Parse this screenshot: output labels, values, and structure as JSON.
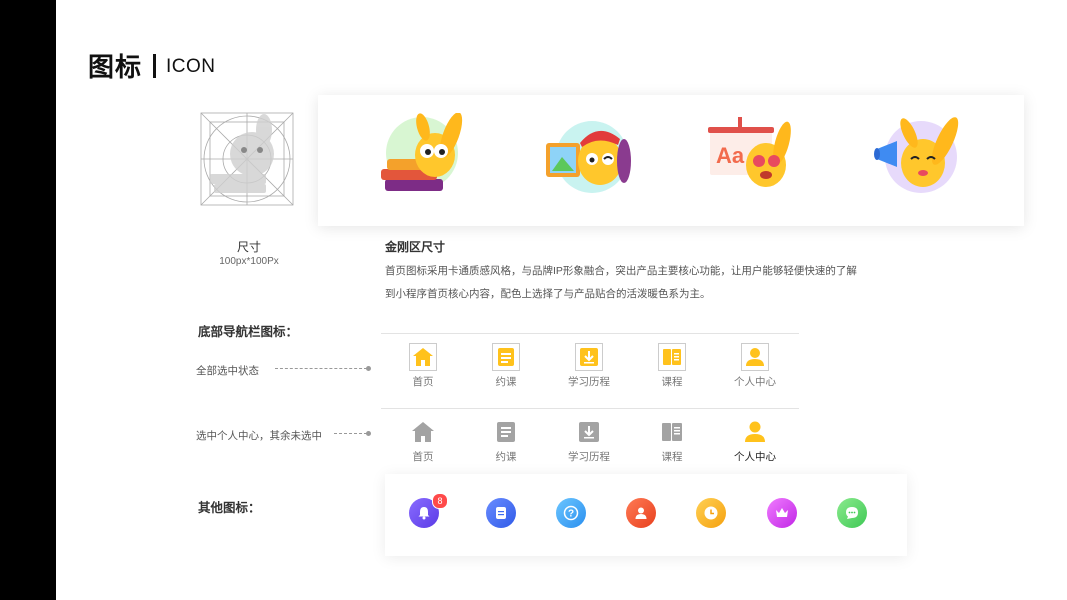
{
  "header": {
    "title_zh": "图标",
    "title_en": "ICON"
  },
  "size_spec": {
    "label": "尺寸",
    "value": "100px*100Px"
  },
  "jingang": {
    "title": "金刚区尺寸",
    "line1": "首页图标采用卡通质感风格，与品牌IP形象融合，突出产品主要核心功能，让用户能够轻便快速的了解",
    "line2": "到小程序首页核心内容，配色上选择了与产品贴合的活泼暖色系为主。",
    "mascots": [
      "books-mascot-icon",
      "painting-mascot-icon",
      "language-mascot-icon",
      "megaphone-mascot-icon"
    ]
  },
  "bottom_nav": {
    "section_title": "底部导航栏图标：",
    "row1_label": "全部选中状态",
    "row2_label": "选中个人中心，其余未选中",
    "items": [
      {
        "label": "首页",
        "icon": "home-icon"
      },
      {
        "label": "约课",
        "icon": "booking-icon"
      },
      {
        "label": "学习历程",
        "icon": "download-icon"
      },
      {
        "label": "课程",
        "icon": "book-icon"
      },
      {
        "label": "个人中心",
        "icon": "user-icon"
      }
    ],
    "colors": {
      "active": "#FFC21C",
      "inactive": "#A3A3A3"
    }
  },
  "other_icons": {
    "section_title": "其他图标：",
    "notification_count": "8",
    "icons": [
      {
        "name": "bell-icon",
        "color": "#6A4BF2"
      },
      {
        "name": "document-icon",
        "color": "#3F6CF0"
      },
      {
        "name": "help-icon",
        "color": "#36A4F5"
      },
      {
        "name": "person-icon",
        "color": "#F0502E"
      },
      {
        "name": "clock-icon",
        "color": "#F7B21A"
      },
      {
        "name": "crown-icon",
        "color": "#D546F0"
      },
      {
        "name": "chat-icon",
        "color": "#56D66A"
      }
    ]
  }
}
